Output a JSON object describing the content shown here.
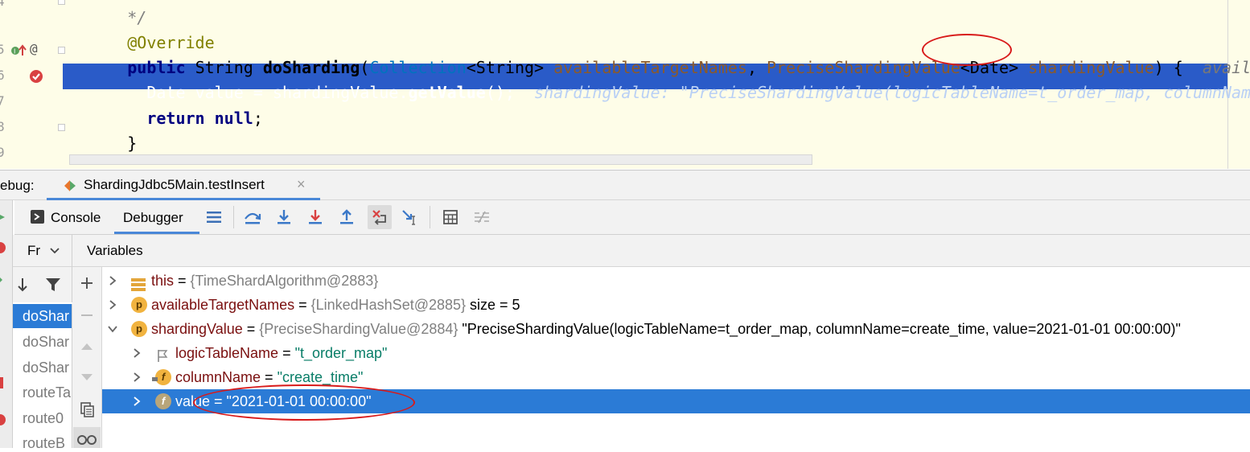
{
  "editor": {
    "line_numbers": [
      "4",
      "5",
      "6",
      "7",
      "8",
      "9"
    ],
    "comment_tail": "*/",
    "annotation": "@Override",
    "signature": {
      "kw_public": "public",
      "type_string": "String",
      "method": "doSharding",
      "paren_open": "(",
      "collection": "Collection",
      "generic_string": "<String>",
      "param1": "availableTargetNames",
      "comma": ",",
      "precise": "PreciseShardingValue",
      "generic_date": "<Date>",
      "param2": "shardingValue",
      "paren_close": ") {",
      "hint": "availab"
    },
    "exec_line": {
      "type": "Date",
      "var": "value",
      "eq": "=",
      "target": "shardingValue.",
      "call": "getValue",
      "end": "();",
      "hint": "shardingValue: \"PreciseShardingValue(logicTableName=t_order_map, columnName"
    },
    "return_line": {
      "kw_return": "return",
      "kw_null": "null",
      "semi": ";"
    },
    "closing_brace": "}"
  },
  "debug_bar": {
    "label": "ebug:",
    "tab_title": "ShardingJdbc5Main.testInsert"
  },
  "toolbar": {
    "console_label": "Console",
    "debugger_label": "Debugger"
  },
  "frames": {
    "header": "Fr",
    "items": [
      {
        "label": "doShar",
        "selected": true
      },
      {
        "label": "doShar",
        "selected": false
      },
      {
        "label": "doShar",
        "selected": false
      },
      {
        "label": "routeTa",
        "selected": false
      },
      {
        "label": "route0",
        "selected": false
      },
      {
        "label": "routeB",
        "selected": false
      }
    ]
  },
  "variables": {
    "header": "Variables",
    "rows": [
      {
        "name": "this",
        "eq": " = ",
        "value": "{TimeShardAlgorithm@2883}",
        "extra": "",
        "icon": "field-list-icon",
        "indent": 0,
        "expanded": false,
        "selected": false
      },
      {
        "name": "availableTargetNames",
        "eq": " = ",
        "value": "{LinkedHashSet@2885}",
        "extra": " size = 5",
        "icon": "p",
        "indent": 0,
        "expanded": false,
        "selected": false
      },
      {
        "name": "shardingValue",
        "eq": " = ",
        "value": "{PreciseShardingValue@2884}",
        "extra": " \"PreciseShardingValue(logicTableName=t_order_map, columnName=create_time, value=2021-01-01 00:00:00)\"",
        "icon": "p",
        "indent": 0,
        "expanded": true,
        "selected": false
      },
      {
        "name": "logicTableName",
        "eq": " = ",
        "value": "\"t_order_map\"",
        "extra": "",
        "icon": "flag",
        "indent": 1,
        "expanded": false,
        "selected": false
      },
      {
        "name": "columnName",
        "eq": " = ",
        "value": "\"create_time\"",
        "extra": "",
        "icon": "f",
        "indent": 1,
        "expanded": false,
        "selected": false
      },
      {
        "name": "value",
        "eq": " = ",
        "value": "\"2021-01-01 00:00:00\"",
        "extra": "",
        "icon": "f",
        "indent": 1,
        "expanded": false,
        "selected": true
      }
    ]
  },
  "colors": {
    "editor_bg": "#fefde8",
    "exec_line": "#2a5bc8",
    "selection": "#2b7bd6",
    "annotation_ellipse": "#d81a1a"
  }
}
